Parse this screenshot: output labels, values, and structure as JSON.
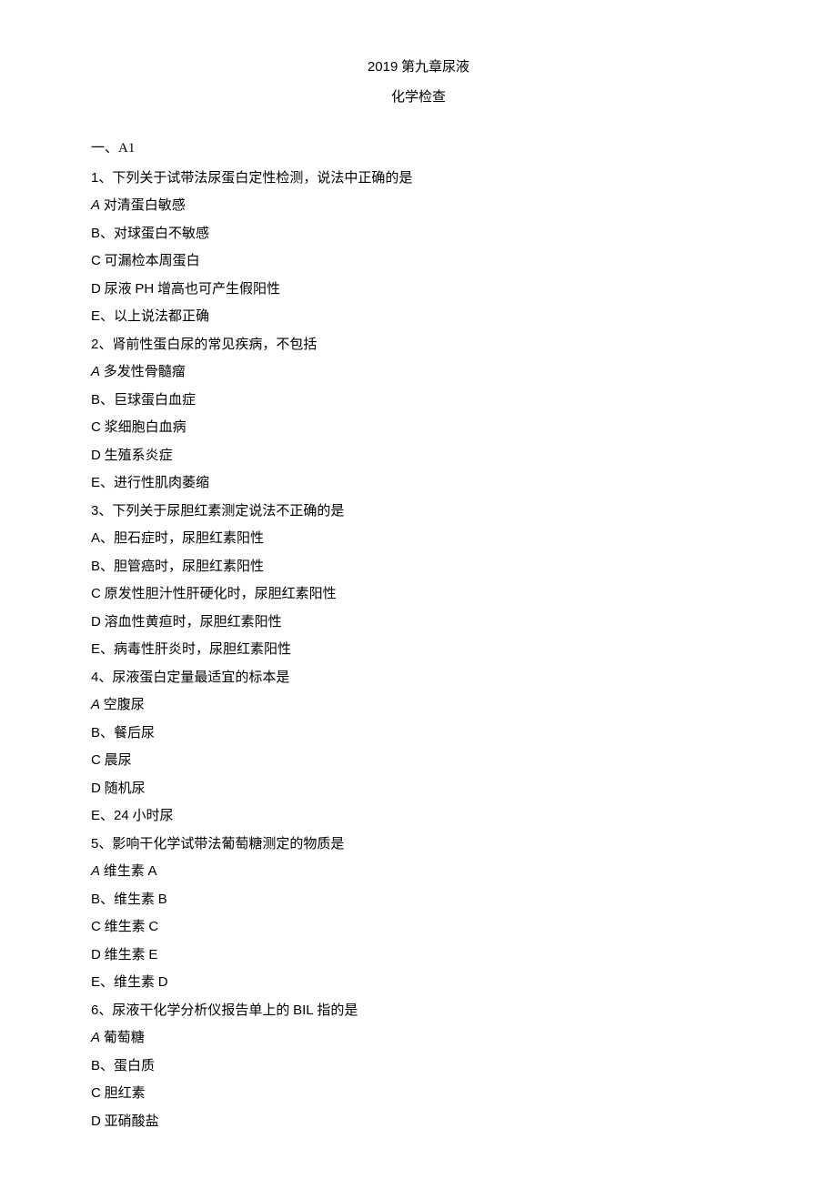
{
  "header": {
    "title_prefix": "2019",
    "title_suffix": " 第九章尿液",
    "subtitle": "化学检查"
  },
  "section": {
    "label": "一、A1"
  },
  "questions": [
    {
      "num": "1、",
      "stem": "下列关于试带法尿蛋白定性检测，说法中正确的是",
      "opts": [
        {
          "label": "A",
          "italic": true,
          "sep": " ",
          "text": "对清蛋白敏感"
        },
        {
          "label": "B",
          "italic": false,
          "sep": "、",
          "text": "对球蛋白不敏感"
        },
        {
          "label": "C",
          "italic": false,
          "sep": " ",
          "text": "可漏检本周蛋白"
        },
        {
          "label": "D",
          "italic": false,
          "sep": " ",
          "text_prefix": "尿液 ",
          "roman": "PH",
          "text_suffix": " 增高也可产生假阳性"
        },
        {
          "label": "E",
          "italic": false,
          "sep": "、",
          "text": "以上说法都正确"
        }
      ]
    },
    {
      "num": "2、",
      "stem": "肾前性蛋白尿的常见疾病，不包括",
      "opts": [
        {
          "label": "A",
          "italic": true,
          "sep": " ",
          "text": "多发性骨髓瘤"
        },
        {
          "label": "B",
          "italic": false,
          "sep": "、",
          "text": "巨球蛋白血症"
        },
        {
          "label": "C",
          "italic": false,
          "sep": " ",
          "text": "浆细胞白血病"
        },
        {
          "label": "D",
          "italic": false,
          "sep": " ",
          "text": "生殖系炎症"
        },
        {
          "label": "E",
          "italic": false,
          "sep": "、",
          "text": "进行性肌肉萎缩"
        }
      ]
    },
    {
      "num": "3、",
      "stem": "下列关于尿胆红素测定说法不正确的是",
      "opts": [
        {
          "label": "A",
          "italic": false,
          "sep": "、",
          "text": "胆石症时，尿胆红素阳性"
        },
        {
          "label": "B",
          "italic": false,
          "sep": "、",
          "text": "胆管癌时，尿胆红素阳性"
        },
        {
          "label": "C",
          "italic": false,
          "sep": " ",
          "text": "原发性胆汁性肝硬化时，尿胆红素阳性"
        },
        {
          "label": "D",
          "italic": false,
          "sep": " ",
          "text": "溶血性黄疸时，尿胆红素阳性"
        },
        {
          "label": "E",
          "italic": false,
          "sep": "、",
          "text": "病毒性肝炎时，尿胆红素阳性"
        }
      ]
    },
    {
      "num": "4、",
      "stem": "尿液蛋白定量最适宜的标本是",
      "opts": [
        {
          "label": "A",
          "italic": true,
          "sep": " ",
          "text": "空腹尿"
        },
        {
          "label": "B",
          "italic": false,
          "sep": "、",
          "text": "餐后尿"
        },
        {
          "label": "C",
          "italic": false,
          "sep": " ",
          "text": "晨尿"
        },
        {
          "label": "D",
          "italic": false,
          "sep": " ",
          "text": "随机尿"
        },
        {
          "label": "E",
          "italic": false,
          "sep": "、",
          "roman": "24",
          "text_suffix": " 小时尿"
        }
      ]
    },
    {
      "num": "5、",
      "stem": "影响干化学试带法葡萄糖测定的物质是",
      "opts": [
        {
          "label": "A",
          "italic": true,
          "sep": " ",
          "text_prefix": "维生素 ",
          "roman": "A"
        },
        {
          "label": "B",
          "italic": false,
          "sep": "、",
          "text_prefix": "维生素 ",
          "roman": "B"
        },
        {
          "label": "C",
          "italic": false,
          "sep": " ",
          "text_prefix": "维生素 ",
          "roman": "C"
        },
        {
          "label": "D",
          "italic": false,
          "sep": " ",
          "text_prefix": "维生素 ",
          "roman": "E"
        },
        {
          "label": "E",
          "italic": false,
          "sep": "、",
          "text_prefix": "维生素 ",
          "roman": "D"
        }
      ]
    },
    {
      "num": "6、",
      "stem_prefix": "尿液干化学分析仪报告单上的 ",
      "stem_roman": "BIL",
      "stem_suffix": " 指的是",
      "opts": [
        {
          "label": "A",
          "italic": true,
          "sep": " ",
          "text": "葡萄糖"
        },
        {
          "label": "B",
          "italic": false,
          "sep": "、",
          "text": "蛋白质"
        },
        {
          "label": "C",
          "italic": false,
          "sep": " ",
          "text": "胆红素"
        },
        {
          "label": "D",
          "italic": false,
          "sep": " ",
          "text": "亚硝酸盐"
        }
      ]
    }
  ]
}
